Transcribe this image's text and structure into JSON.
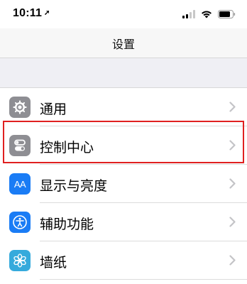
{
  "status_bar": {
    "time": "10:11",
    "location_glyph": "➚",
    "icons": [
      "signal-icon",
      "wifi-icon",
      "battery-icon"
    ]
  },
  "nav": {
    "title": "设置"
  },
  "settings": {
    "items": [
      {
        "label": "通用",
        "icon": "gear-icon",
        "icon_color": "#8e8e93"
      },
      {
        "label": "控制中心",
        "icon": "toggles-icon",
        "icon_color": "#8e8e93"
      },
      {
        "label": "显示与亮度",
        "icon": "text-size-icon",
        "icon_color": "#1a7cf5",
        "icon_text": "AA"
      },
      {
        "label": "辅助功能",
        "icon": "accessibility-icon",
        "icon_color": "#1a7cf5"
      },
      {
        "label": "墙纸",
        "icon": "flower-icon",
        "icon_color": "#35aadc"
      }
    ]
  },
  "annotation": {
    "color": "#e02020"
  }
}
